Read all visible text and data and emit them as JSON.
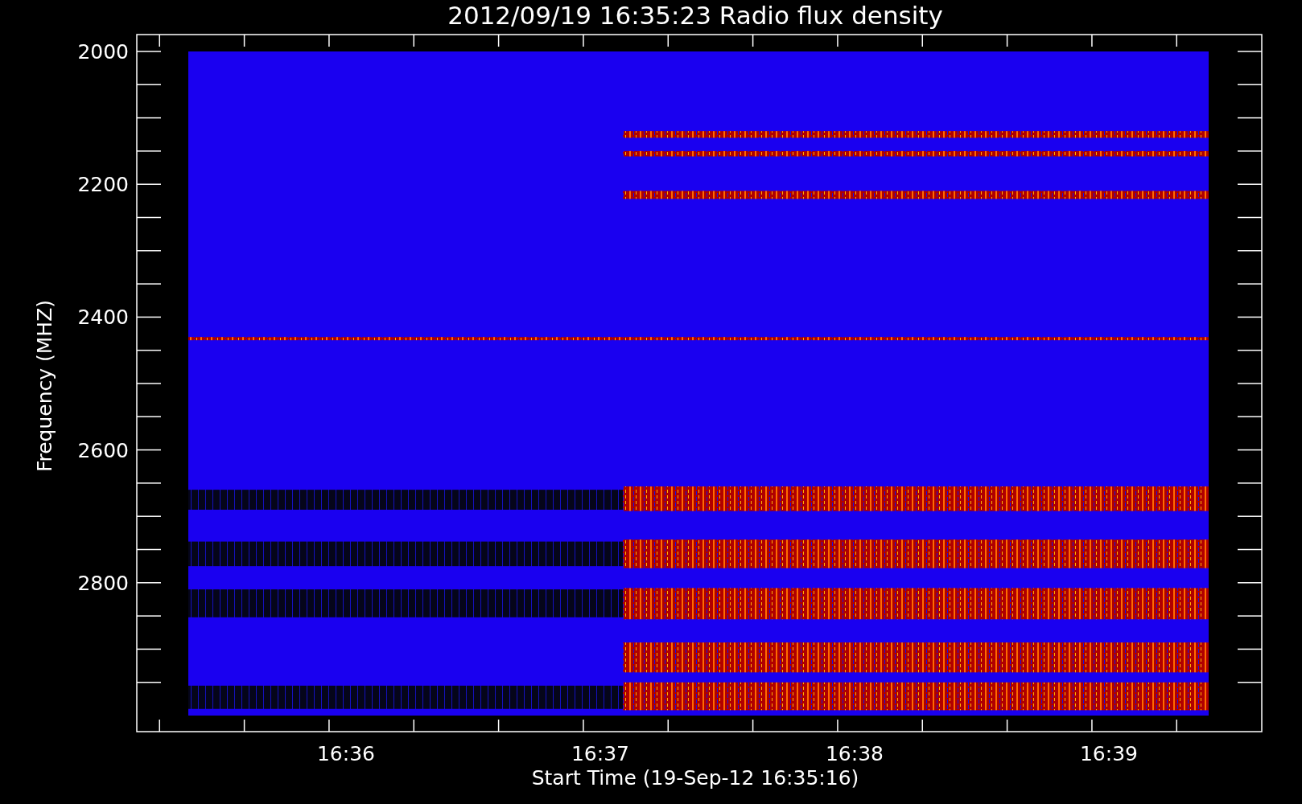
{
  "title": "2012/09/19 16:35:23 Radio flux density",
  "y_axis": {
    "label": "Frequency (MHZ)",
    "ticks": [
      "2000",
      "2200",
      "2400",
      "2600",
      "2800"
    ]
  },
  "x_axis": {
    "label": "Start Time (19-Sep-12 16:35:16)",
    "ticks": [
      "16:36",
      "16:37",
      "16:38",
      "16:39"
    ]
  }
}
